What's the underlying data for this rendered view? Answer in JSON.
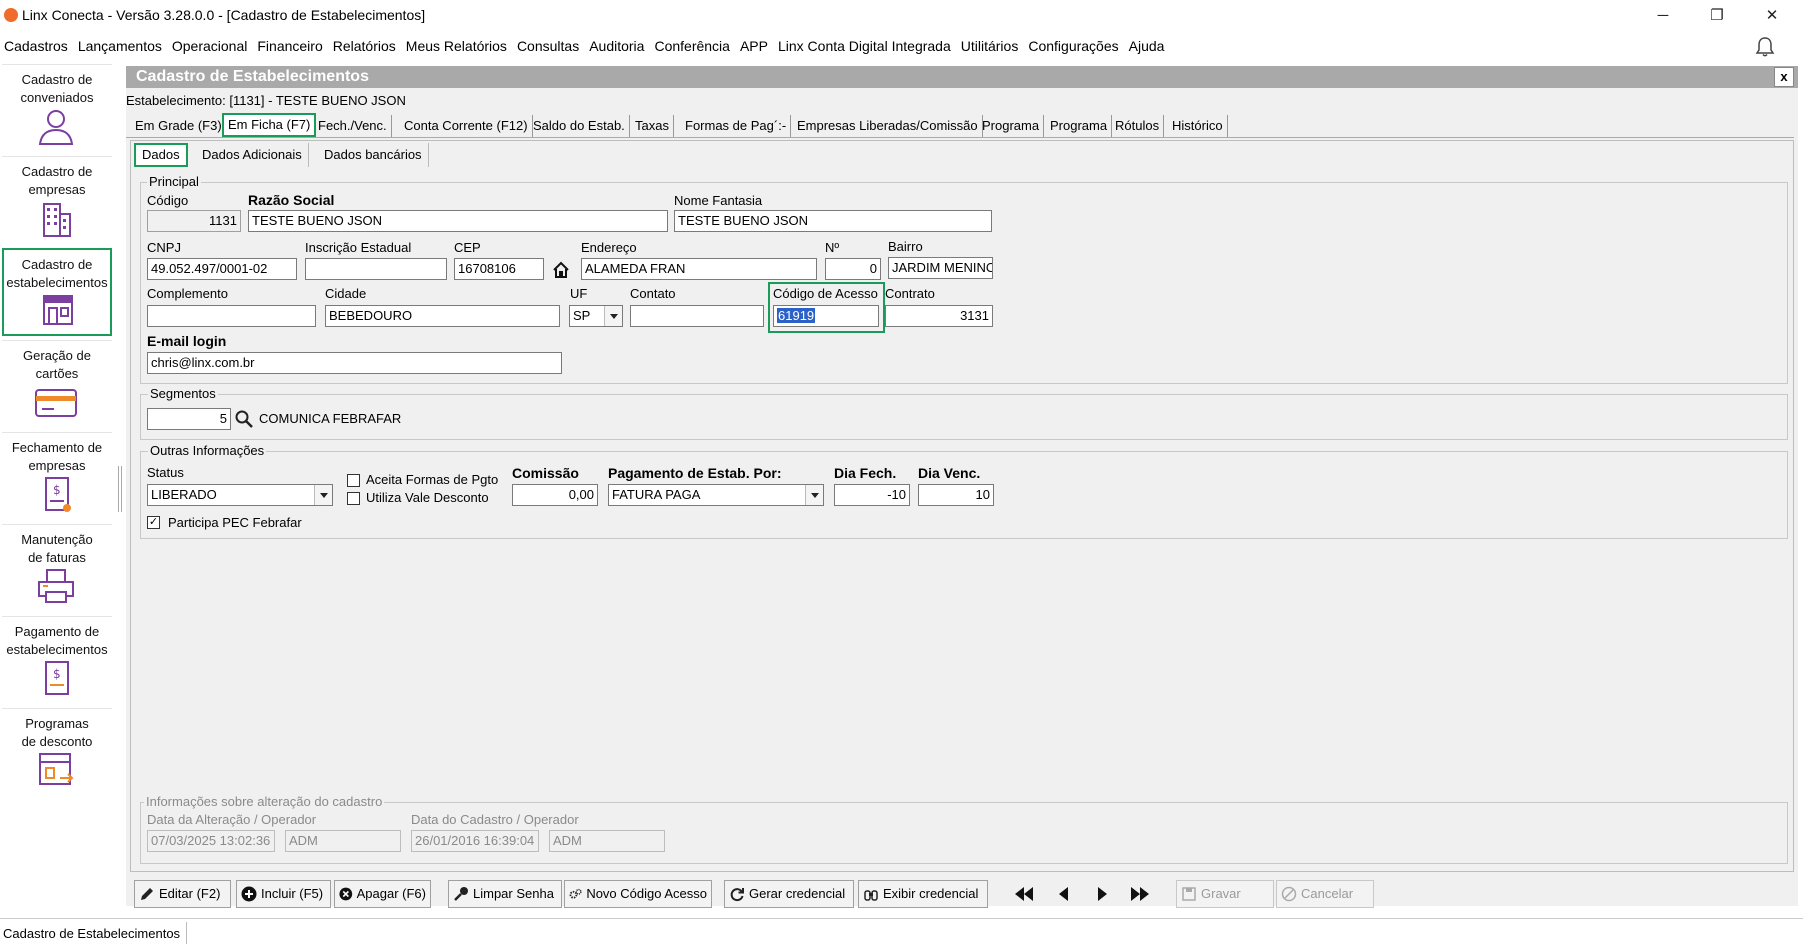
{
  "window": {
    "title": "Linx Conecta - Versão 3.28.0.0 - [Cadastro de Estabelecimentos]",
    "minimize": "─",
    "restore": "❐",
    "close": "✕"
  },
  "menu": [
    "Cadastros",
    "Lançamentos",
    "Operacional",
    "Financeiro",
    "Relatórios",
    "Meus Relatórios",
    "Consultas",
    "Auditoria",
    "Conferência",
    "APP",
    "Linx Conta Digital Integrada",
    "Utilitários",
    "Configurações",
    "Ajuda"
  ],
  "sidebar": {
    "items": [
      {
        "label1": "Cadastro de",
        "label2": "conveniados",
        "icon": "person-icon"
      },
      {
        "label1": "Cadastro de",
        "label2": "empresas",
        "icon": "building-icon"
      },
      {
        "label1": "Cadastro de",
        "label2": "estabelecimentos",
        "icon": "store-icon"
      },
      {
        "label1": "Geração de",
        "label2": "cartões",
        "icon": "card-icon"
      },
      {
        "label1": "Fechamento de",
        "label2": "empresas",
        "icon": "invoice-icon"
      },
      {
        "label1": "Manutenção",
        "label2": "de faturas",
        "icon": "printer-icon"
      },
      {
        "label1": "Pagamento de",
        "label2": "estabelecimentos",
        "icon": "payment-icon"
      },
      {
        "label1": "Programas",
        "label2": "de desconto",
        "icon": "discount-icon"
      }
    ],
    "selected_index": 2,
    "accent": "#7b3fa0"
  },
  "form": {
    "title": "Cadastro de Estabelecimentos",
    "close": "x",
    "estabelecimento": "Estabelecimento: [1131] - TESTE BUENO JSON"
  },
  "tabs": [
    "Em Grade (F3)",
    "Em Ficha (F7)",
    "Fech./Venc.",
    "Conta Corrente (F12)",
    "Saldo do Estab.",
    "Taxas",
    "Formas de Pag´:-",
    "Empresas Liberadas/Comissão",
    "Programa",
    "Programa",
    "Rótulos",
    "Histórico"
  ],
  "subtabs": [
    "Dados",
    "Dados Adicionais",
    "Dados bancários"
  ],
  "principal": {
    "group": "Principal",
    "codigo_label": "Código",
    "codigo": "1131",
    "razao_label": "Razão Social",
    "razao": "TESTE BUENO JSON",
    "fantasia_label": "Nome Fantasia",
    "fantasia": "TESTE BUENO JSON",
    "cnpj_label": "CNPJ",
    "cnpj": "49.052.497/0001-02",
    "ie_label": "Inscrição Estadual",
    "ie": "",
    "cep_label": "CEP",
    "cep": "16708106",
    "endereco_label": "Endereço",
    "endereco": "ALAMEDA FRAN",
    "numero_label": "Nº",
    "numero": "0",
    "bairro_label": "Bairro",
    "bairro": "JARDIM MENINO",
    "complemento_label": "Complemento",
    "complemento": "",
    "cidade_label": "Cidade",
    "cidade": "BEBEDOURO",
    "uf_label": "UF",
    "uf": "SP",
    "contato_label": "Contato",
    "contato": "",
    "acesso_label": "Código de Acesso",
    "acesso": "61919",
    "contrato_label": "Contrato",
    "contrato": "3131",
    "email_label": "E-mail login",
    "email": "chris@linx.com.br"
  },
  "segmentos": {
    "group": "Segmentos",
    "value": "5",
    "name": "COMUNICA FEBRAFAR"
  },
  "outras": {
    "group": "Outras Informações",
    "status_label": "Status",
    "status": "LIBERADO",
    "aceita_label": "Aceita Formas de Pgto",
    "aceita": false,
    "vale_label": "Utiliza Vale Desconto",
    "vale": false,
    "comissao_label": "Comissão",
    "comissao": "0,00",
    "pagamento_label": "Pagamento de Estab. Por:",
    "pagamento": "FATURA PAGA",
    "diafech_label": "Dia Fech.",
    "diafech": "-10",
    "diavenc_label": "Dia Venc.",
    "diavenc": "10",
    "pec_label": "Participa PEC Febrafar",
    "pec": true
  },
  "alteracao": {
    "group": "Informações sobre alteração do cadastro",
    "alt_label": "Data da Alteração / Operador",
    "alt_data": "07/03/2025 13:02:36",
    "alt_op": "ADM",
    "cad_label": "Data do Cadastro / Operador",
    "cad_data": "26/01/2016 16:39:04",
    "cad_op": "ADM"
  },
  "buttons": {
    "editar": "Editar (F2)",
    "incluir": "Incluir (F5)",
    "apagar": "Apagar (F6)",
    "limpar": "Limpar Senha",
    "novo_codigo": "Novo Código Acesso",
    "gerar": "Gerar credencial",
    "exibir": "Exibir credencial",
    "gravar": "Gravar",
    "cancelar": "Cancelar"
  },
  "status_bar": "Cadastro de Estabelecimentos",
  "colors": {
    "highlight": "#1a9b5a",
    "header": "#a9a9a9",
    "selection": "#2b62c9"
  }
}
